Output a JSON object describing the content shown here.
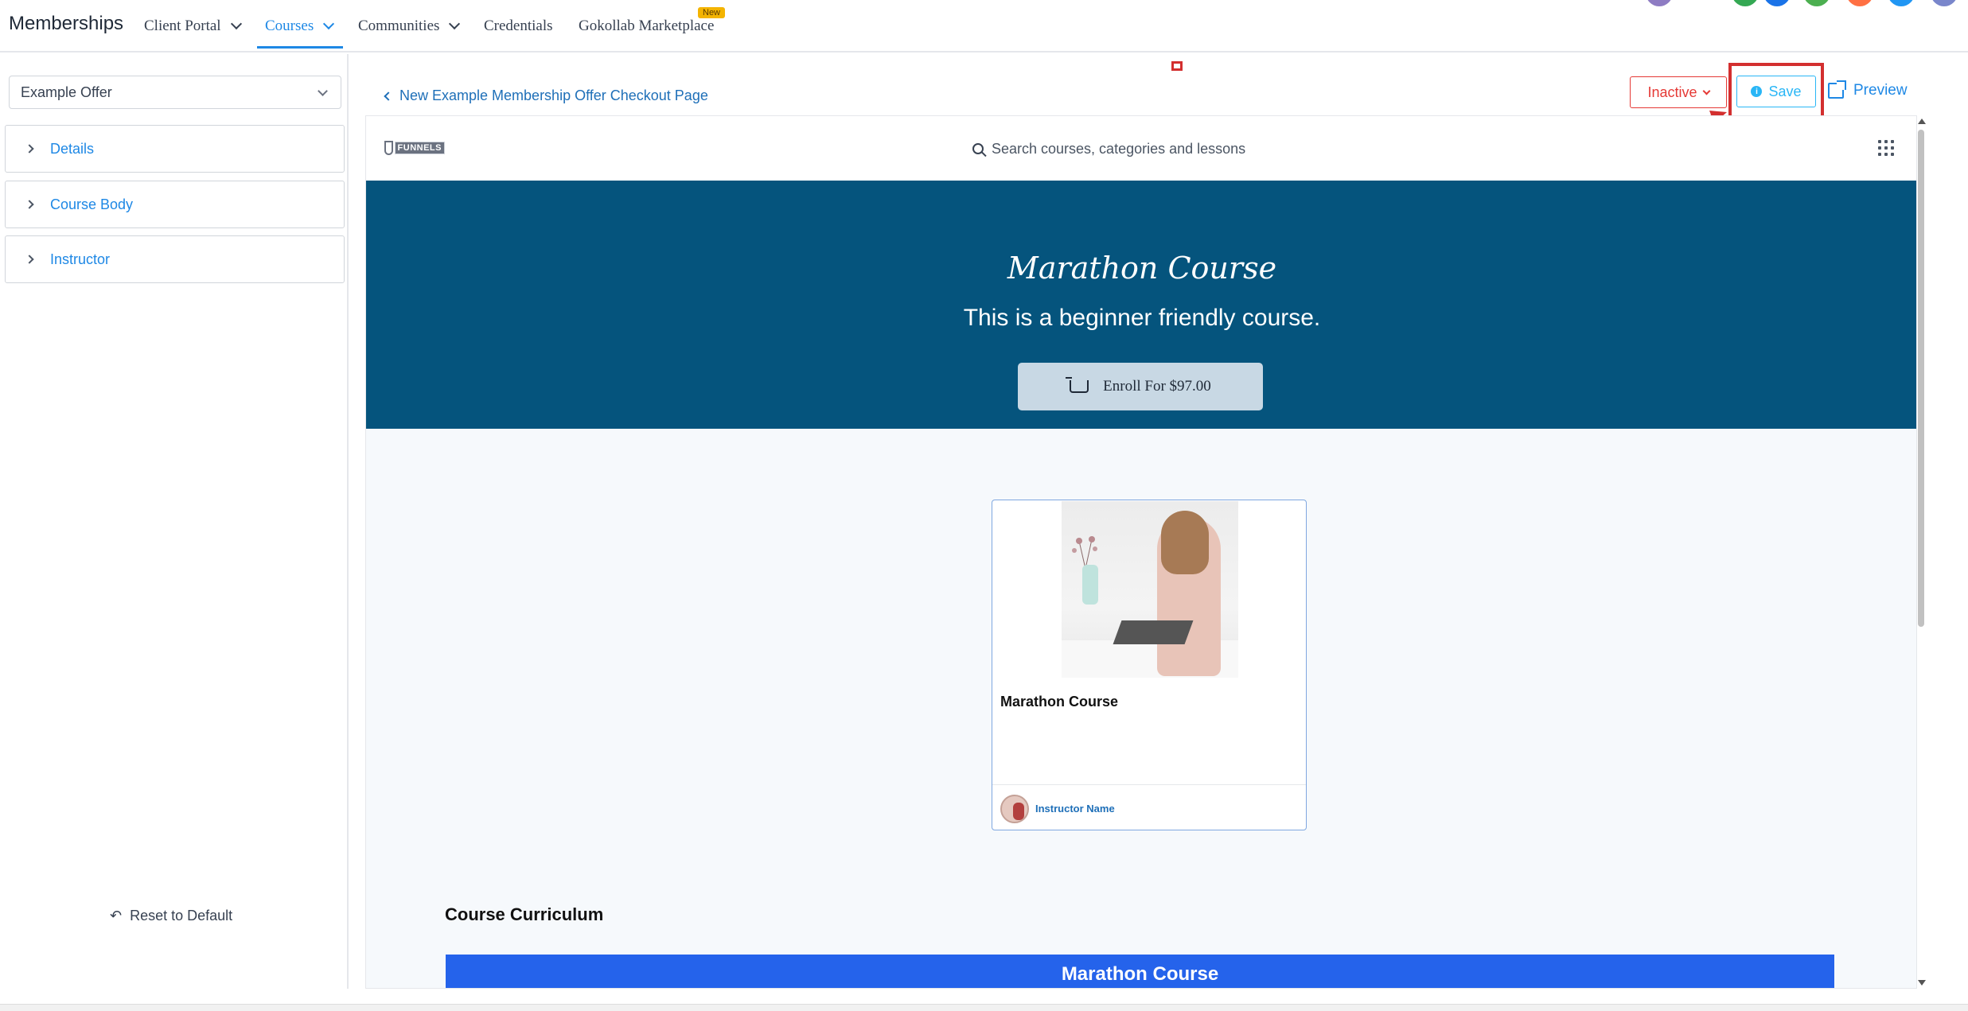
{
  "topnav": {
    "brand": "Memberships",
    "items": [
      {
        "label": "Client Portal"
      },
      {
        "label": "Courses"
      },
      {
        "label": "Communities"
      },
      {
        "label": "Credentials"
      },
      {
        "label": "Gokollab Marketplace"
      }
    ],
    "new_badge": "New"
  },
  "sidebar": {
    "offer_select_value": "Example Offer",
    "sections": [
      {
        "label": "Details"
      },
      {
        "label": "Course Body"
      },
      {
        "label": "Instructor"
      }
    ],
    "reset_label": "Reset to Default"
  },
  "toolbar": {
    "back_label": "New Example Membership Offer Checkout Page",
    "status_label": "Inactive",
    "save_label": "Save",
    "preview_label": "Preview"
  },
  "preview": {
    "logo_text": "FUNNELS",
    "search_placeholder": "Search courses, categories and lessons",
    "hero_title": "Marathon Course",
    "hero_subtitle": "This is a beginner friendly course.",
    "enroll_label": "Enroll For $97.00",
    "card": {
      "title": "Marathon Course",
      "instructor": "Instructor Name"
    },
    "curriculum_title": "Course Curriculum",
    "curriculum_bar": "Marathon Course"
  },
  "colors": {
    "accent": "#1e88e5",
    "hero_bg": "#05547d",
    "danger": "#e53935",
    "save": "#29b6f6",
    "curriculum": "#2563eb"
  }
}
